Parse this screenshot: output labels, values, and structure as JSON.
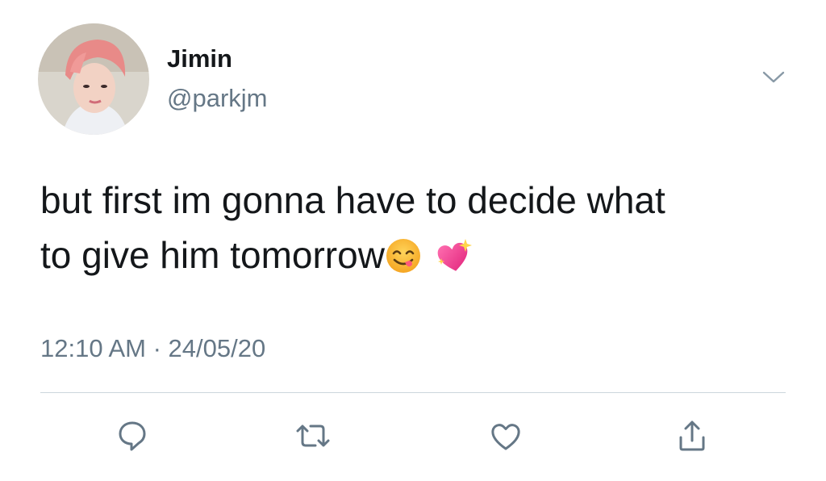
{
  "tweet": {
    "author": {
      "display_name": "Jimin",
      "handle": "@parkjm",
      "avatar_icon": "profile-photo"
    },
    "text_lines": [
      "but first im gonna have to decide what",
      "to give him tomorrow"
    ],
    "emojis": [
      "face-savoring-food",
      "sparkling-heart"
    ],
    "timestamp": "12:10 AM · 24/05/20"
  },
  "menu": {
    "icon": "chevron-down-icon"
  },
  "actions": [
    {
      "name": "reply",
      "icon": "reply-icon"
    },
    {
      "name": "retweet",
      "icon": "retweet-icon"
    },
    {
      "name": "like",
      "icon": "heart-icon"
    },
    {
      "name": "share",
      "icon": "share-icon"
    }
  ],
  "colors": {
    "text": "#14171a",
    "secondary_text": "#657786",
    "divider": "#ccd6dd",
    "icon": "#657786"
  }
}
